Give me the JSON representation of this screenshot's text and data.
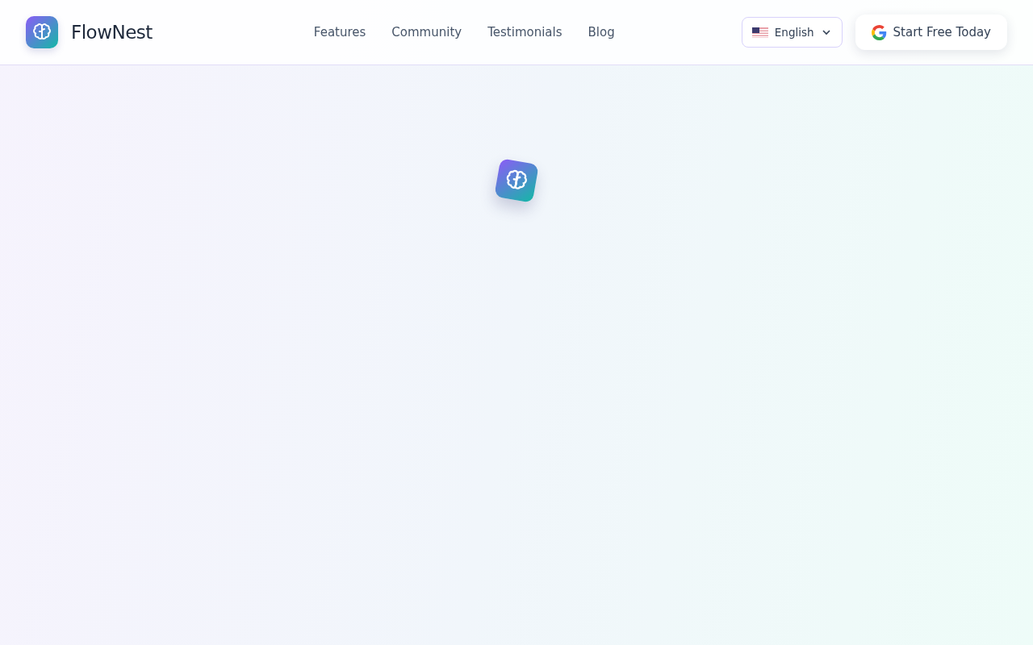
{
  "brand": {
    "name": "FlowNest"
  },
  "nav": [
    {
      "label": "Features"
    },
    {
      "label": "Community"
    },
    {
      "label": "Testimonials"
    },
    {
      "label": "Blog"
    }
  ],
  "language": {
    "label": "English"
  },
  "cta": {
    "label": "Start Free Today"
  }
}
